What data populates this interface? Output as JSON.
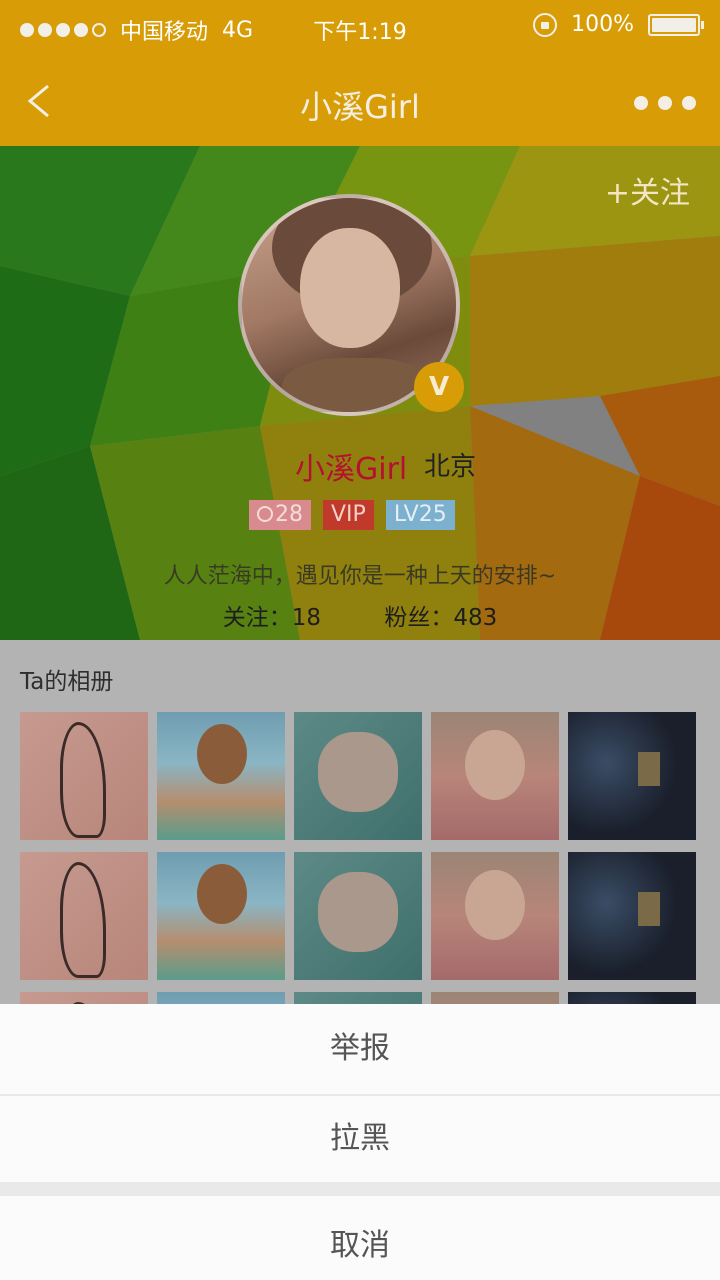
{
  "status_bar": {
    "carrier": "中国移动",
    "network": "4G",
    "time": "下午1:19",
    "battery": "100%",
    "signal_bars_filled": 4,
    "signal_bars_total": 5
  },
  "nav": {
    "title": "小溪Girl",
    "back_icon": "chevron-left-icon",
    "more_icon": "more-dots-icon"
  },
  "profile": {
    "follow_label": "+关注",
    "name": "小溪Girl",
    "city": "北京",
    "verified_badge": "V",
    "age": "28",
    "vip_label": "VIP",
    "level": "LV25",
    "bio": "人人茫海中，遇见你是一种上天的安排~",
    "following_label": "关注：18",
    "followers_label": "粉丝：483"
  },
  "album": {
    "title": "Ta的相册"
  },
  "action_sheet": {
    "report": "举报",
    "block": "拉黑",
    "cancel": "取消"
  },
  "colors": {
    "nav_bar": "#d89c06",
    "name_text": "#b5102f",
    "vip_badge": "#c0392b",
    "level_badge": "#7cb0cf"
  }
}
